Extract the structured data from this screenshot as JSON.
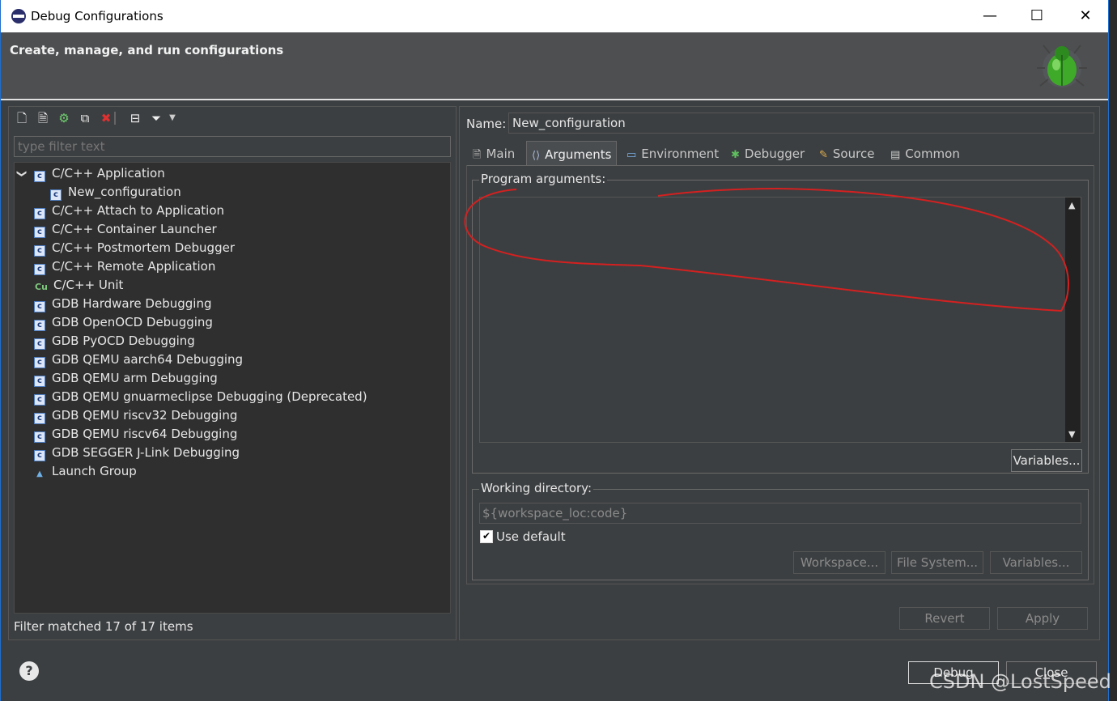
{
  "window": {
    "title": "Debug Configurations",
    "minimize_glyph": "—",
    "maximize_glyph": "☐",
    "close_glyph": "✕"
  },
  "banner": {
    "text": "Create, manage, and run configurations",
    "icon": "bug-icon"
  },
  "left_panel": {
    "toolbar_icons": [
      "new-config-icon",
      "new-prototype-icon",
      "export-icon",
      "duplicate-icon",
      "delete-icon",
      "collapse-all-icon",
      "filter-icon",
      "dropdown-icon"
    ],
    "filter_placeholder": "type filter text",
    "tree": [
      {
        "label": "C/C++ Application",
        "expanded": true,
        "icon": "c-config-icon"
      },
      {
        "label": "New_configuration",
        "child": true,
        "icon": "c-config-icon"
      },
      {
        "label": "C/C++ Attach to Application",
        "icon": "c-config-icon"
      },
      {
        "label": "C/C++ Container Launcher",
        "icon": "c-config-icon"
      },
      {
        "label": "C/C++ Postmortem Debugger",
        "icon": "c-config-icon"
      },
      {
        "label": "C/C++ Remote Application",
        "icon": "c-config-icon"
      },
      {
        "label": "C/C++ Unit",
        "icon": "cu-unit-icon"
      },
      {
        "label": "GDB Hardware Debugging",
        "icon": "c-config-icon"
      },
      {
        "label": "GDB OpenOCD Debugging",
        "icon": "c-config-icon"
      },
      {
        "label": "GDB PyOCD Debugging",
        "icon": "c-config-icon"
      },
      {
        "label": "GDB QEMU aarch64 Debugging",
        "icon": "c-config-icon"
      },
      {
        "label": "GDB QEMU arm Debugging",
        "icon": "c-config-icon"
      },
      {
        "label": "GDB QEMU gnuarmeclipse Debugging (Deprecated)",
        "icon": "c-config-icon"
      },
      {
        "label": "GDB QEMU riscv32 Debugging",
        "icon": "c-config-icon"
      },
      {
        "label": "GDB QEMU riscv64 Debugging",
        "icon": "c-config-icon"
      },
      {
        "label": "GDB SEGGER J-Link Debugging",
        "icon": "c-config-icon"
      },
      {
        "label": "Launch Group",
        "icon": "launch-group-icon"
      }
    ],
    "status": "Filter matched 17 of 17 items"
  },
  "right_panel": {
    "name_label": "Name:",
    "name_value": "New_configuration",
    "tabs": [
      {
        "label": "Main",
        "icon": "main-tab-icon"
      },
      {
        "label": "Arguments",
        "icon": "arguments-tab-icon",
        "active": true
      },
      {
        "label": "Environment",
        "icon": "environment-tab-icon"
      },
      {
        "label": "Debugger",
        "icon": "debugger-tab-icon"
      },
      {
        "label": "Source",
        "icon": "source-tab-icon"
      },
      {
        "label": "Common",
        "icon": "common-tab-icon"
      }
    ],
    "program_arguments": {
      "label": "Program arguments:",
      "value": "",
      "variables_button": "Variables..."
    },
    "working_directory": {
      "label": "Working directory:",
      "value": "${workspace_loc:code}",
      "use_default_label": "Use default",
      "use_default_checked": true,
      "workspace_button": "Workspace...",
      "filesystem_button": "File System...",
      "variables_button": "Variables..."
    },
    "revert_button": "Revert",
    "apply_button": "Apply"
  },
  "footer": {
    "help_glyph": "?",
    "debug_button": "Debug",
    "close_button": "Close"
  },
  "watermark": "CSDN @LostSpeed",
  "colors": {
    "annotation": "#d42020",
    "title_bar": "#ffffff",
    "border_accent": "#1f6fcf"
  }
}
